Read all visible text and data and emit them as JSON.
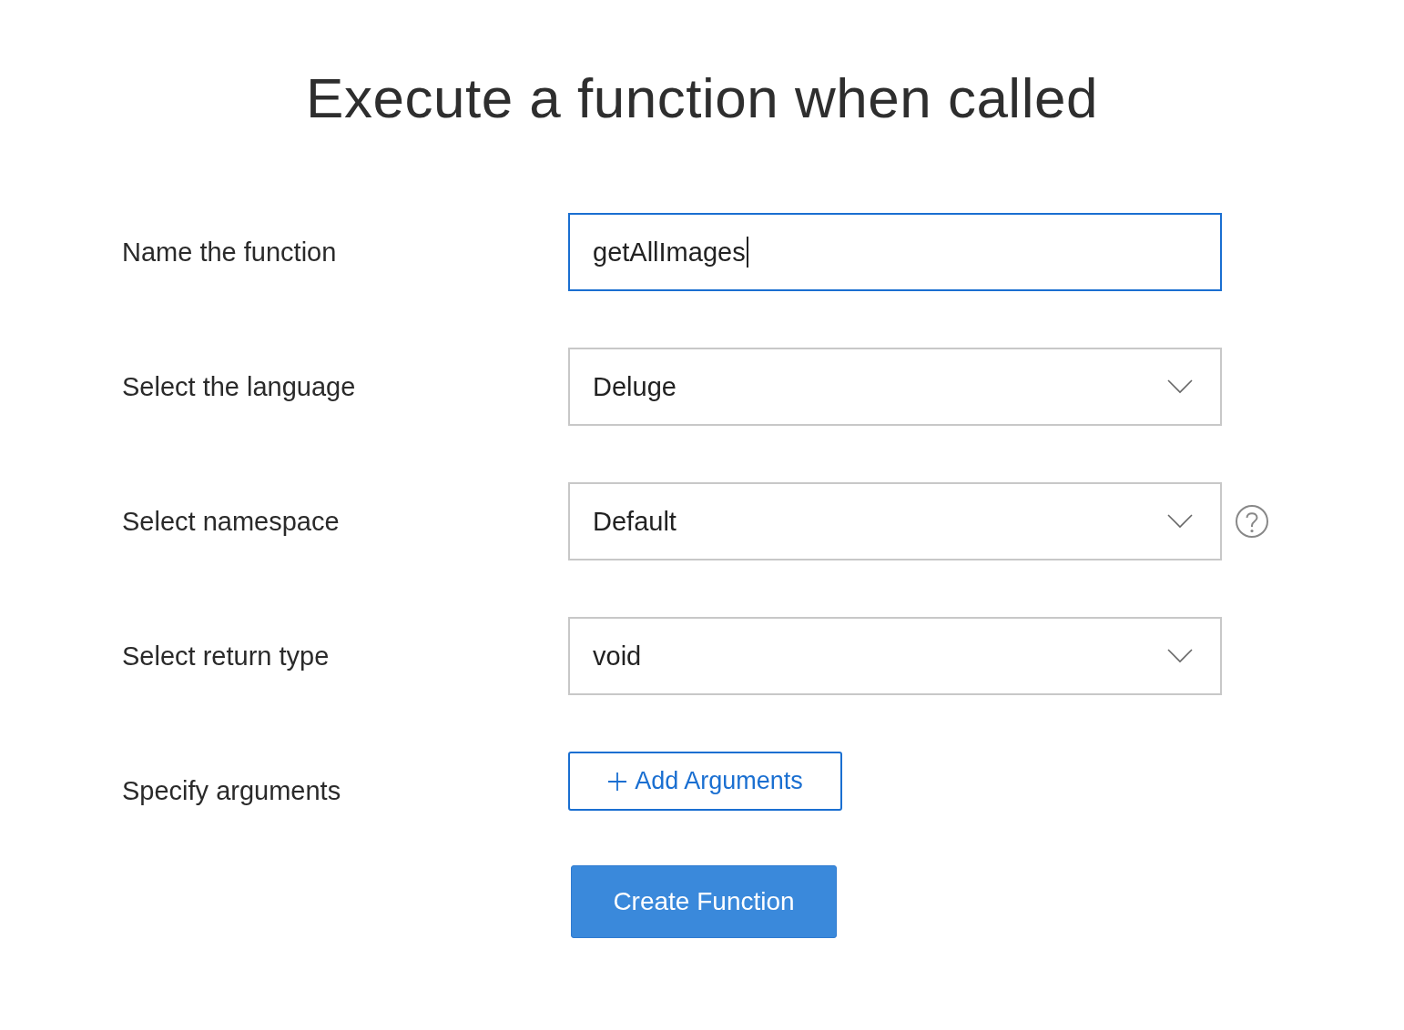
{
  "title": "Execute a function when called",
  "rows": [
    {
      "label": "Name the function",
      "kind": "text",
      "value": "getAllImages",
      "focused": true
    },
    {
      "label": "Select the language",
      "kind": "select",
      "value": "Deluge"
    },
    {
      "label": "Select namespace",
      "kind": "select",
      "value": "Default",
      "help": true
    },
    {
      "label": "Select return type",
      "kind": "select",
      "value": "void"
    },
    {
      "label": "Specify arguments",
      "kind": "button",
      "value": "Add Arguments"
    }
  ],
  "submit": "Create Function"
}
